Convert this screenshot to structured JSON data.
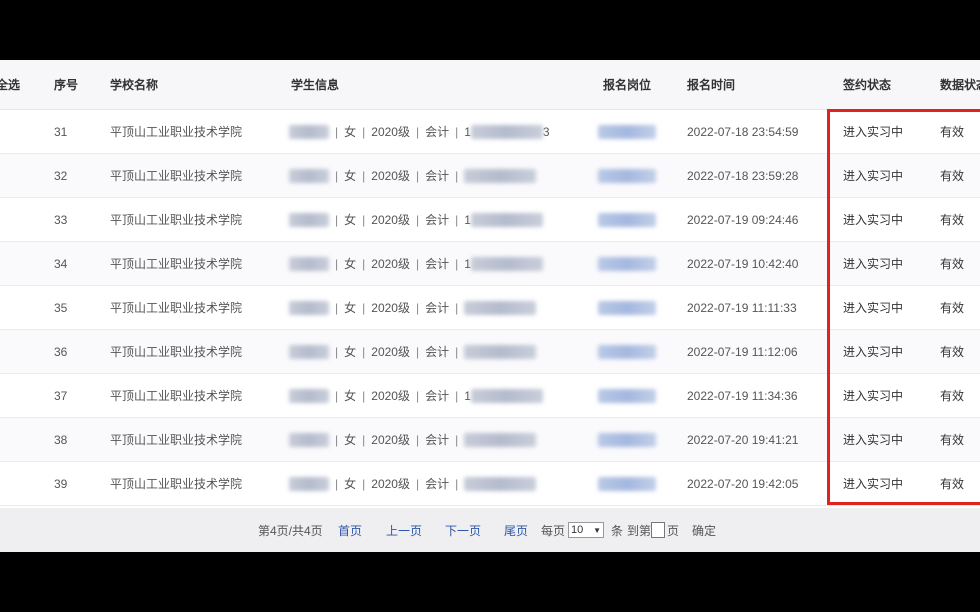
{
  "table": {
    "headers": {
      "select_all": "全选",
      "seq": "序号",
      "school": "学校名称",
      "student": "学生信息",
      "position": "报名岗位",
      "time": "报名时间",
      "sign_status": "签约状态",
      "data_status": "数据状态"
    },
    "rows": [
      {
        "seq": "31",
        "school": "平顶山工业职业技术学院",
        "prefix": "",
        "suffix": "",
        "gender": "女",
        "grade": "2020级",
        "major": "会计",
        "phone_hint": "1",
        "phone_tail": "3",
        "time": "2022-07-18 23:54:59",
        "sign_status": "进入实习中",
        "data_status": "有效"
      },
      {
        "seq": "32",
        "school": "平顶山工业职业技术学院",
        "prefix": "",
        "suffix": "",
        "gender": "女",
        "grade": "2020级",
        "major": "会计",
        "phone_hint": "",
        "phone_tail": "",
        "time": "2022-07-18 23:59:28",
        "sign_status": "进入实习中",
        "data_status": "有效"
      },
      {
        "seq": "33",
        "school": "平顶山工业职业技术学院",
        "prefix": "",
        "suffix": "",
        "gender": "女",
        "grade": "2020级",
        "major": "会计",
        "phone_hint": "1",
        "phone_tail": "",
        "time": "2022-07-19 09:24:46",
        "sign_status": "进入实习中",
        "data_status": "有效"
      },
      {
        "seq": "34",
        "school": "平顶山工业职业技术学院",
        "prefix": "",
        "suffix": "",
        "gender": "女",
        "grade": "2020级",
        "major": "会计",
        "phone_hint": "1",
        "phone_tail": "",
        "time": "2022-07-19 10:42:40",
        "sign_status": "进入实习中",
        "data_status": "有效"
      },
      {
        "seq": "35",
        "school": "平顶山工业职业技术学院",
        "prefix": "",
        "suffix": "",
        "gender": "女",
        "grade": "2020级",
        "major": "会计",
        "phone_hint": "",
        "phone_tail": "",
        "time": "2022-07-19 11:11:33",
        "sign_status": "进入实习中",
        "data_status": "有效"
      },
      {
        "seq": "36",
        "school": "平顶山工业职业技术学院",
        "prefix": "",
        "suffix": "",
        "gender": "女",
        "grade": "2020级",
        "major": "会计",
        "phone_hint": "",
        "phone_tail": "",
        "time": "2022-07-19 11:12:06",
        "sign_status": "进入实习中",
        "data_status": "有效"
      },
      {
        "seq": "37",
        "school": "平顶山工业职业技术学院",
        "prefix": "",
        "suffix": "",
        "gender": "女",
        "grade": "2020级",
        "major": "会计",
        "phone_hint": "1",
        "phone_tail": "",
        "time": "2022-07-19 11:34:36",
        "sign_status": "进入实习中",
        "data_status": "有效"
      },
      {
        "seq": "38",
        "school": "平顶山工业职业技术学院",
        "prefix": "",
        "suffix": "",
        "gender": "女",
        "grade": "2020级",
        "major": "会计",
        "phone_hint": "",
        "phone_tail": "",
        "time": "2022-07-20 19:41:21",
        "sign_status": "进入实习中",
        "data_status": "有效"
      },
      {
        "seq": "39",
        "school": "平顶山工业职业技术学院",
        "prefix": "",
        "suffix": "",
        "gender": "女",
        "grade": "2020级",
        "major": "会计",
        "phone_hint": "",
        "phone_tail": "",
        "time": "2022-07-20 19:42:05",
        "sign_status": "进入实习中",
        "data_status": "有效"
      }
    ],
    "separator": "|"
  },
  "pager": {
    "page_info": "第4页/共4页",
    "first": "首页",
    "prev": "上一页",
    "next": "下一页",
    "last": "尾页",
    "per_page_label": "每页",
    "per_page_value": "10",
    "per_page_unit": "条",
    "goto_label": "到第",
    "goto_unit": "页",
    "confirm": "确定"
  },
  "colors": {
    "highlight": "#e0231f",
    "link": "#2b56a8"
  }
}
